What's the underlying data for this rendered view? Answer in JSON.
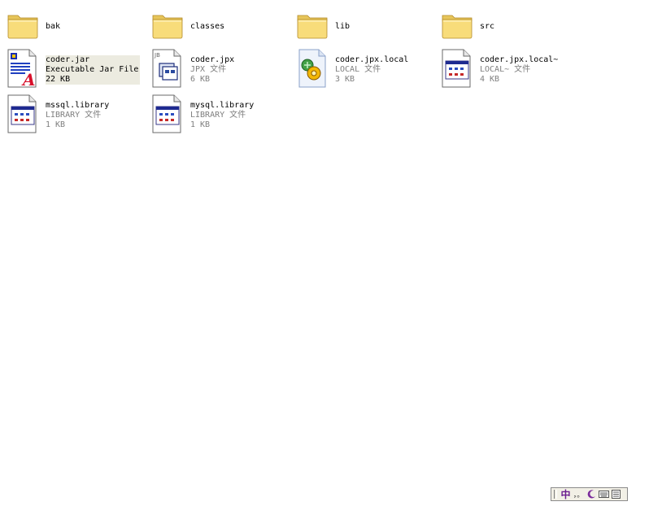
{
  "items": [
    {
      "name": "bak",
      "kind": "folder"
    },
    {
      "name": "classes",
      "kind": "folder"
    },
    {
      "name": "lib",
      "kind": "folder"
    },
    {
      "name": "src",
      "kind": "folder"
    },
    {
      "name": "coder.jar",
      "type": "Executable Jar File",
      "size": "22 KB",
      "icon": "jar-file-icon",
      "selected": true
    },
    {
      "name": "coder.jpx",
      "type": "JPX 文件",
      "size": "6 KB",
      "icon": "jbuilder-project-icon"
    },
    {
      "name": "coder.jpx.local",
      "type": "LOCAL 文件",
      "size": "3 KB",
      "icon": "local-config-icon"
    },
    {
      "name": "coder.jpx.local~",
      "type": "LOCAL~ 文件",
      "size": "4 KB",
      "icon": "generic-window-file-icon"
    },
    {
      "name": "mssql.library",
      "type": "LIBRARY 文件",
      "size": "1 KB",
      "icon": "generic-window-file-icon"
    },
    {
      "name": "mysql.library",
      "type": "LIBRARY 文件",
      "size": "1 KB",
      "icon": "generic-window-file-icon"
    }
  ],
  "ime_bar": {
    "mode_label": "中",
    "punct_label": "，。",
    "icons": [
      "ime-mode-icon",
      "ime-punctuation-icon",
      "ime-moon-icon",
      "ime-keyboard-icon",
      "ime-menu-icon"
    ]
  }
}
